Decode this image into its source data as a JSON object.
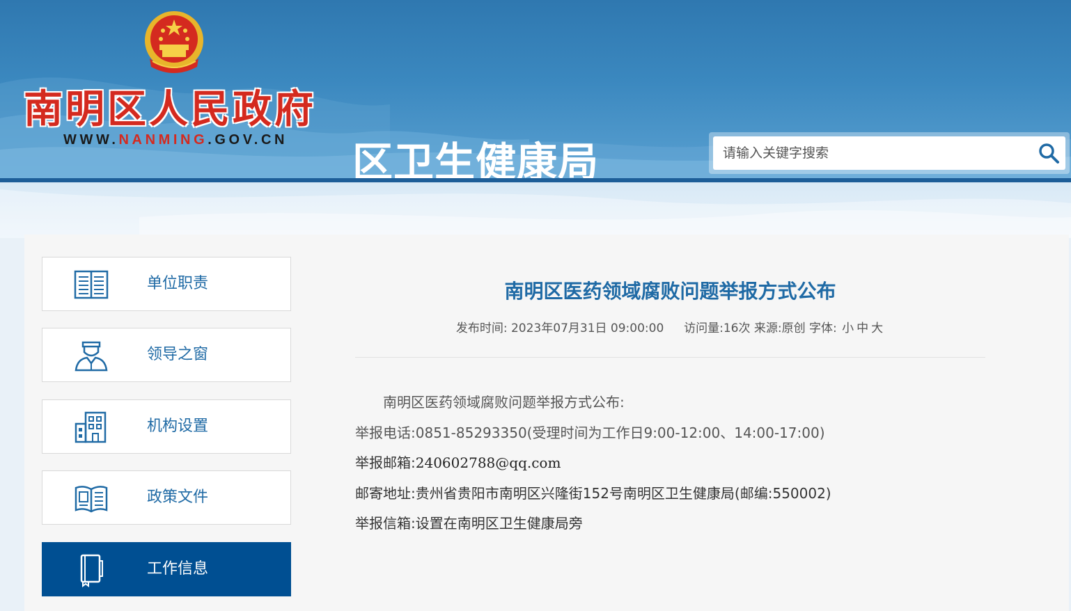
{
  "header": {
    "site_title": "南明区人民政府",
    "site_url_prefix": "WWW.",
    "site_url_mid": "NANMING",
    "site_url_suffix": ".GOV.CN",
    "department": "区卫生健康局",
    "search_placeholder": "请输入关键字搜索"
  },
  "sidebar": {
    "items": [
      {
        "label": "单位职责",
        "icon": "book-icon",
        "active": false
      },
      {
        "label": "领导之窗",
        "icon": "person-icon",
        "active": false
      },
      {
        "label": "机构设置",
        "icon": "building-icon",
        "active": false
      },
      {
        "label": "政策文件",
        "icon": "open-book-icon",
        "active": false
      },
      {
        "label": "工作信息",
        "icon": "notebook-icon",
        "active": true
      }
    ]
  },
  "article": {
    "title": "南明区医药领域腐败问题举报方式公布",
    "meta": {
      "publish_label": "发布时间:",
      "publish_time": "2023年07月31日 09:00:00",
      "views_label": "访问量:",
      "views": "16次",
      "source_label": "来源:",
      "source": "原创",
      "font_label": "字体:",
      "font_small": "小",
      "font_medium": "中",
      "font_large": "大"
    },
    "intro": "南明区医药领域腐败问题举报方式公布:",
    "phone_label": "举报电话:",
    "phone": "0851-85293350(受理时间为工作日9:00-12:00、14:00-17:00)",
    "email_label": "举报邮箱:",
    "email": "240602788@qq.com",
    "address_label": "邮寄地址:",
    "address": "贵州省贵阳市南明区兴隆街152号南明区卫生健康局(邮编:550002)",
    "mailbox_label": "举报信箱:",
    "mailbox": "设置在南明区卫生健康局旁"
  },
  "colors": {
    "brand_blue": "#1f6aa5",
    "active_nav": "#004f92",
    "title_red": "#d42a1f"
  }
}
